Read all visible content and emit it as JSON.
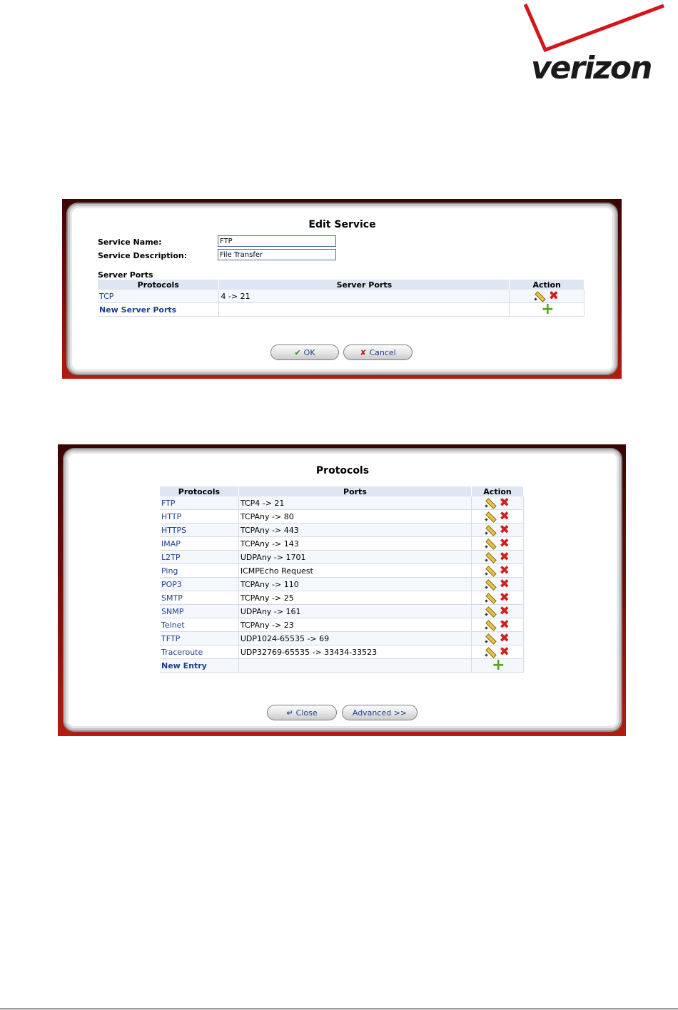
{
  "logo": {
    "text": "verizon"
  },
  "edit_service": {
    "title": "Edit Service",
    "service_name_label": "Service Name:",
    "service_name_value": "FTP",
    "service_description_label": "Service Description:",
    "service_description_value": "File Transfer",
    "server_ports_label": "Server Ports",
    "columns": [
      "Protocols",
      "Server Ports",
      "Action"
    ],
    "rows": [
      {
        "protocol": "TCP",
        "ports": "4 -> 21"
      }
    ],
    "new_row_label": "New Server Ports",
    "ok_label": "OK",
    "cancel_label": "Cancel"
  },
  "protocols_dialog": {
    "title": "Protocols",
    "columns": [
      "Protocols",
      "Ports",
      "Action"
    ],
    "rows": [
      {
        "protocol": "FTP",
        "ports": "TCP4 -> 21"
      },
      {
        "protocol": "HTTP",
        "ports": "TCPAny -> 80"
      },
      {
        "protocol": "HTTPS",
        "ports": "TCPAny -> 443"
      },
      {
        "protocol": "IMAP",
        "ports": "TCPAny -> 143"
      },
      {
        "protocol": "L2TP",
        "ports": "UDPAny -> 1701"
      },
      {
        "protocol": "Ping",
        "ports": "ICMPEcho Request"
      },
      {
        "protocol": "POP3",
        "ports": "TCPAny -> 110"
      },
      {
        "protocol": "SMTP",
        "ports": "TCPAny -> 25"
      },
      {
        "protocol": "SNMP",
        "ports": "UDPAny -> 161"
      },
      {
        "protocol": "Telnet",
        "ports": "TCPAny -> 23"
      },
      {
        "protocol": "TFTP",
        "ports": "UDP1024-65535 -> 69"
      },
      {
        "protocol": "Traceroute",
        "ports": "UDP32769-65535 -> 33434-33523"
      }
    ],
    "new_row_label": "New Entry",
    "close_label": "Close",
    "advanced_label": "Advanced >>"
  },
  "icons": {
    "edit": "pencil-icon",
    "delete": "delete-icon",
    "add": "add-icon"
  },
  "colors": {
    "frame_red": "#8b1208",
    "link_blue": "#1f3f8c",
    "header_bg": "#dfe6f3"
  }
}
